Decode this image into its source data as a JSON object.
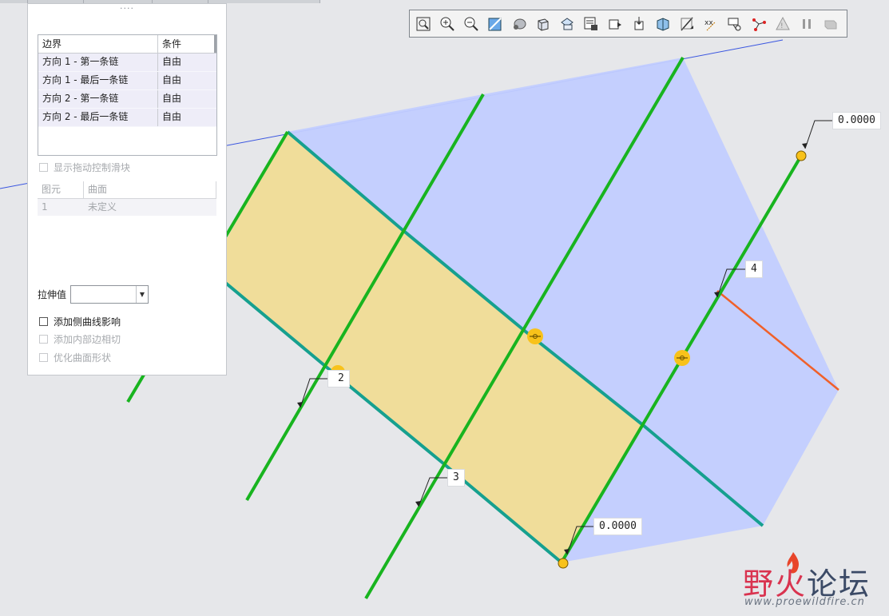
{
  "panel": {
    "grip": "····",
    "boundary_table": {
      "headers": [
        "边界",
        "条件"
      ],
      "rows": [
        [
          "方向 1 - 第一条链",
          "自由"
        ],
        [
          "方向 1 - 最后一条链",
          "自由"
        ],
        [
          "方向 2 - 第一条链",
          "自由"
        ],
        [
          "方向 2 - 最后一条链",
          "自由"
        ]
      ]
    },
    "show_drag_sliders": {
      "label": "显示拖动控制滑块",
      "checked": false,
      "enabled": false
    },
    "element_table": {
      "headers": [
        "图元",
        "曲面"
      ],
      "rows": [
        [
          "1",
          "未定义"
        ]
      ]
    },
    "stretch_value": {
      "label": "拉伸值",
      "value": ""
    },
    "add_side_curve": {
      "label": "添加侧曲线影响",
      "checked": false,
      "enabled": true
    },
    "add_inner_tangent": {
      "label": "添加内部边相切",
      "checked": false,
      "enabled": false
    },
    "optimize_surface": {
      "label": "优化曲面形状",
      "checked": false,
      "enabled": false
    }
  },
  "toolbar": {
    "buttons": [
      "zoom-refit-icon",
      "zoom-in-icon",
      "zoom-out-icon",
      "repaint-icon",
      "spin-center-icon",
      "display-style-icon",
      "saved-views-icon",
      "view-manager-icon",
      "plane-display-icon",
      "axis-display-icon",
      "csys-display-icon",
      "annotation-display-icon",
      "point-display-icon",
      "constraint-display-icon",
      "network-icon",
      "regenerate-icon",
      "pause-icon",
      "stop-icon"
    ]
  },
  "dimensions": [
    {
      "id": "top-right",
      "text": "0.0000"
    },
    {
      "id": "chain-4",
      "text": "4"
    },
    {
      "id": "chain-2",
      "text": "2"
    },
    {
      "id": "chain-3",
      "text": "3"
    },
    {
      "id": "bottom",
      "text": "0.0000"
    }
  ],
  "watermark": {
    "logo_red": "野火",
    "logo_dark": "论坛",
    "url": "www.proewildfire.cn"
  },
  "colors": {
    "background": "#e6e7ea",
    "yellow_surface": "#f0dd9a",
    "blue_surface": "#c2ceff",
    "green_curve": "#18b41f",
    "teal_curve": "#16a08f",
    "orange_edge": "#f0602a",
    "datum_line": "#3a56e0",
    "handle": "#f8c21a"
  }
}
